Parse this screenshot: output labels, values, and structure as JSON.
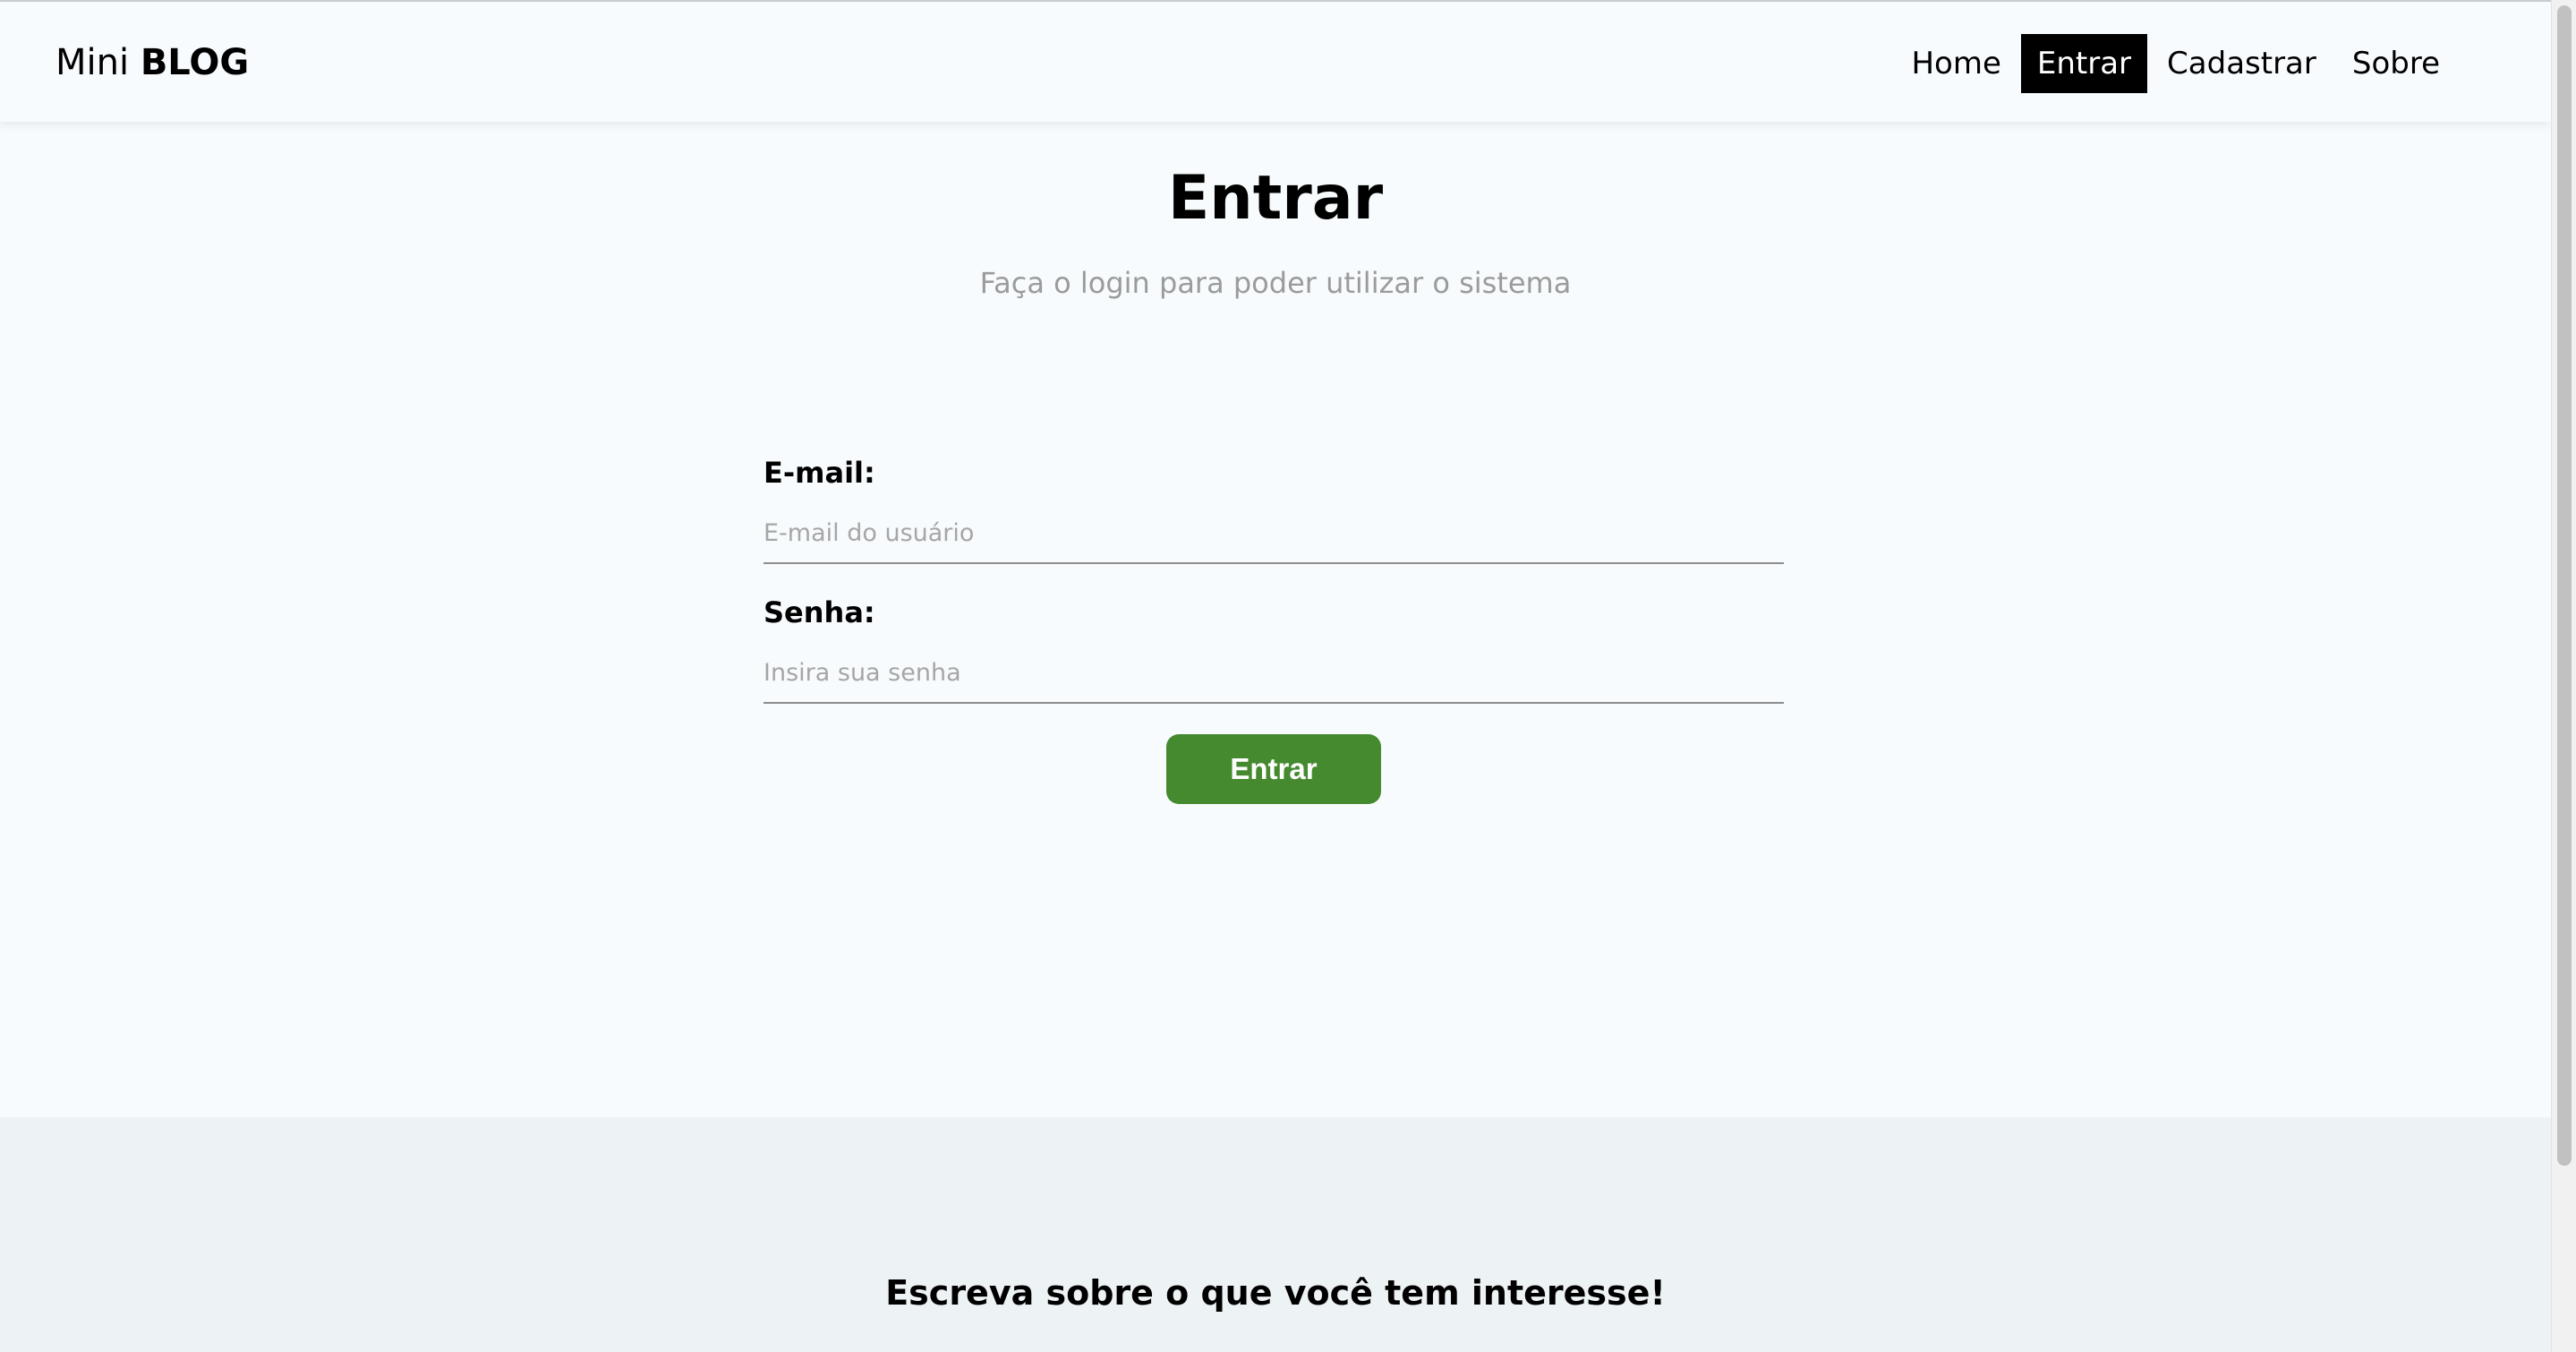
{
  "navbar": {
    "brand_light": "Mini",
    "brand_bold": "BLOG",
    "links": [
      {
        "label": "Home"
      },
      {
        "label": "Entrar",
        "active": true
      },
      {
        "label": "Cadastrar"
      },
      {
        "label": "Sobre"
      }
    ]
  },
  "login": {
    "title": "Entrar",
    "subtitle": "Faça o login para poder utilizar o sistema",
    "email": {
      "label": "E-mail:",
      "placeholder": "E-mail do usuário",
      "value": ""
    },
    "password": {
      "label": "Senha:",
      "placeholder": "Insira sua senha",
      "value": ""
    },
    "submit_label": "Entrar"
  },
  "footer": {
    "text": "Escreva sobre o que você tem interesse!"
  },
  "colors": {
    "background": "#f7fbfd",
    "footer_background": "#edf2f4",
    "active_nav_background": "#000000",
    "submit_button": "#468a2f",
    "muted_text": "#9b9b9b"
  }
}
